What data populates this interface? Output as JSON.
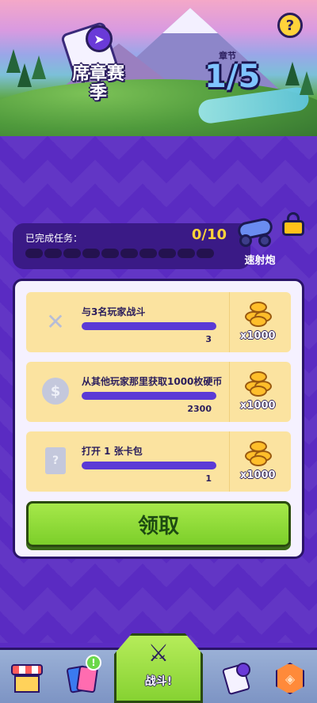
{
  "banner": {
    "season_title": "席章赛季",
    "chapter_label": "章节",
    "chapter_value": "1/5",
    "help_label": "?"
  },
  "progress": {
    "label": "已完成任务：",
    "count": "0/10",
    "completed": 0,
    "total": 10,
    "reward_name": "速射炮"
  },
  "quests": [
    {
      "title": "与3名玩家战斗",
      "value": "3",
      "reward": "x1000",
      "icon": "swords-icon"
    },
    {
      "title": "从其他玩家那里获取1000枚硬币",
      "value": "2300",
      "reward": "x1000",
      "icon": "coin-icon"
    },
    {
      "title": "打开 1 张卡包",
      "value": "1",
      "reward": "x1000",
      "icon": "ticket-icon"
    }
  ],
  "claim_button": "领取",
  "nav": {
    "battle_label": "战斗!",
    "cards_badge": "!"
  },
  "colors": {
    "background": "#5a2bc2",
    "accent_green": "#86d232",
    "gold": "#ffd33a",
    "quest_card": "#fbe3a0",
    "progress_bar": "#5b3ad6"
  }
}
